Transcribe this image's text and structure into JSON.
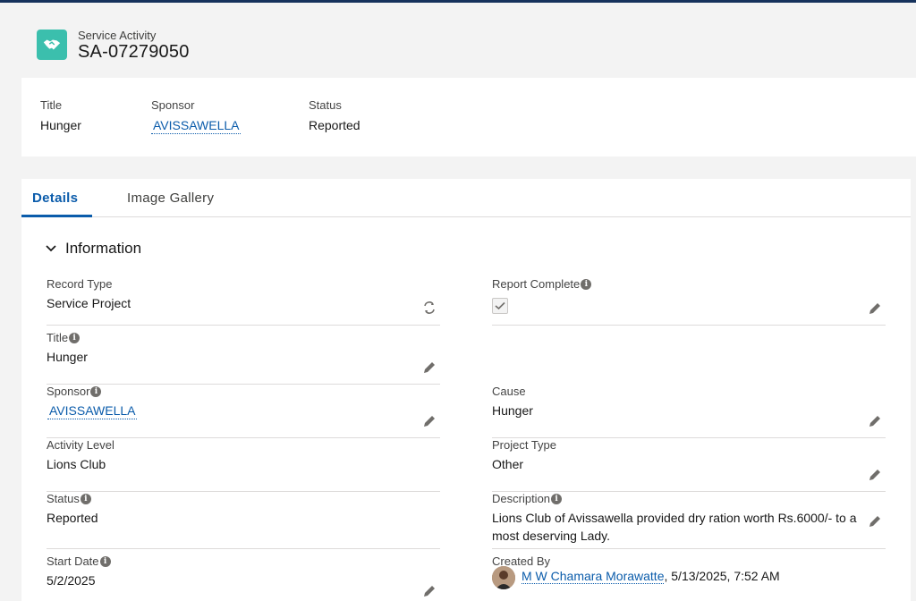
{
  "record": {
    "object_label": "Service Activity",
    "name": "SA-07279050",
    "icon": "handshake-icon",
    "icon_color": "#3bbfad"
  },
  "highlights": [
    {
      "label": "Title",
      "value": "Hunger"
    },
    {
      "label": "Sponsor",
      "value": "AVISSAWELLA"
    },
    {
      "label": "Status",
      "value": "Reported"
    }
  ],
  "tabs": [
    {
      "label": "Details",
      "active": true
    },
    {
      "label": "Image Gallery",
      "active": false
    }
  ],
  "section": {
    "title": "Information"
  },
  "fields": {
    "record_type": {
      "label": "Record Type",
      "value": "Service Project"
    },
    "report_complete": {
      "label": "Report Complete",
      "checked": true
    },
    "title": {
      "label": "Title",
      "value": "Hunger"
    },
    "sponsor": {
      "label": "Sponsor",
      "value": "AVISSAWELLA"
    },
    "cause": {
      "label": "Cause",
      "value": "Hunger"
    },
    "activity_level": {
      "label": "Activity Level",
      "value": "Lions Club"
    },
    "project_type": {
      "label": "Project Type",
      "value": "Other"
    },
    "status": {
      "label": "Status",
      "value": "Reported"
    },
    "description": {
      "label": "Description",
      "value": "Lions Club of Avissawella provided dry ration worth Rs.6000/- to a most deserving Lady."
    },
    "start_date": {
      "label": "Start Date",
      "value": "5/2/2025"
    },
    "created_by": {
      "label": "Created By",
      "user": "M W Chamara Morawatte",
      "datetime": ", 5/13/2025, 7:52 AM"
    }
  },
  "colors": {
    "accent": "#0b5cab",
    "header_bar": "#16325c"
  }
}
